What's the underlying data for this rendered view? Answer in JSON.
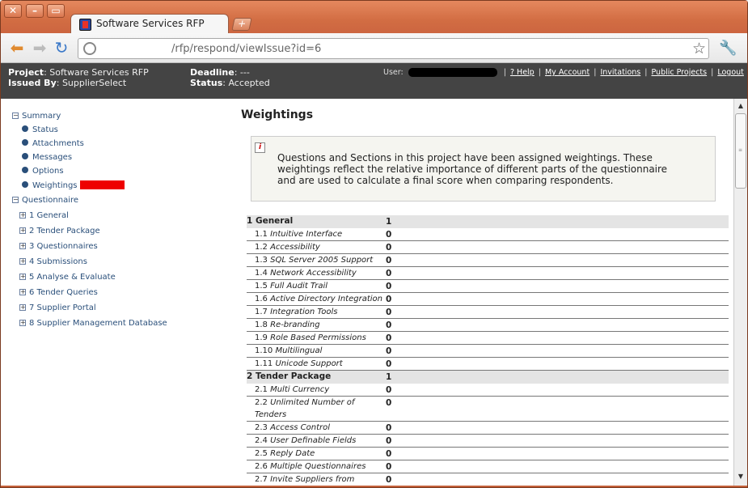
{
  "browser": {
    "tab_title": "Software Services RFP",
    "url": "/rfp/respond/viewIssue?id=6"
  },
  "header": {
    "project_label": "Project",
    "project_value": ": Software Services RFP",
    "issued_label": "Issued By",
    "issued_value": ": SupplierSelect",
    "deadline_label": "Deadline",
    "deadline_value": ": ---",
    "status_label": "Status",
    "status_value": ": Accepted",
    "user_label": "User:",
    "links": [
      "? Help",
      "My Account",
      "Invitations",
      "Public Projects",
      "Logout"
    ]
  },
  "sidebar": {
    "summary": "Summary",
    "summary_items": [
      "Status",
      "Attachments",
      "Messages",
      "Options",
      "Weightings"
    ],
    "questionnaire": "Questionnaire",
    "questionnaire_items": [
      "1 General",
      "2 Tender Package",
      "3 Questionnaires",
      "4 Submissions",
      "5 Analyse & Evaluate",
      "6 Tender Queries",
      "7 Supplier Portal",
      "8 Supplier Management Database"
    ]
  },
  "main": {
    "title": "Weightings",
    "notice": "Questions and Sections in this project have been assigned weightings. These weightings reflect the relative importance of different parts of the questionnaire and are used to calculate a final score when comparing respondents."
  },
  "weightings": [
    {
      "num": "1",
      "name": "General",
      "value": "1",
      "section": true
    },
    {
      "num": "1.1",
      "name": "Intuitive Interface",
      "value": "0"
    },
    {
      "num": "1.2",
      "name": "Accessibility",
      "value": "0"
    },
    {
      "num": "1.3",
      "name": "SQL Server 2005 Support",
      "value": "0"
    },
    {
      "num": "1.4",
      "name": "Network Accessibility",
      "value": "0"
    },
    {
      "num": "1.5",
      "name": "Full Audit Trail",
      "value": "0"
    },
    {
      "num": "1.6",
      "name": "Active Directory Integration",
      "value": "0"
    },
    {
      "num": "1.7",
      "name": "Integration Tools",
      "value": "0"
    },
    {
      "num": "1.8",
      "name": "Re-branding",
      "value": "0"
    },
    {
      "num": "1.9",
      "name": "Role Based Permissions",
      "value": "0"
    },
    {
      "num": "1.10",
      "name": "Multilingual",
      "value": "0"
    },
    {
      "num": "1.11",
      "name": "Unicode Support",
      "value": "0"
    },
    {
      "num": "2",
      "name": "Tender Package",
      "value": "1",
      "section": true
    },
    {
      "num": "2.1",
      "name": "Multi Currency",
      "value": "0"
    },
    {
      "num": "2.2",
      "name": "Unlimited Number of Tenders",
      "value": "0",
      "tall": true
    },
    {
      "num": "2.3",
      "name": "Access Control",
      "value": "0"
    },
    {
      "num": "2.4",
      "name": "User Definable Fields",
      "value": "0"
    },
    {
      "num": "2.5",
      "name": "Reply Date",
      "value": "0"
    },
    {
      "num": "2.6",
      "name": "Multiple Questionnaires",
      "value": "0"
    },
    {
      "num": "2.7",
      "name": "Invite Suppliers from",
      "value": "0"
    }
  ]
}
